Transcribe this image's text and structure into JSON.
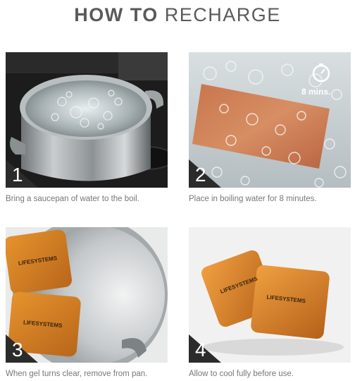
{
  "title": {
    "bold": "HOW TO",
    "light": "RECHARGE"
  },
  "steps": [
    {
      "number": "1",
      "caption": "Bring a saucepan of water to the boil."
    },
    {
      "number": "2",
      "caption": "Place in boiling water for 8 minutes.",
      "timer_label": "8 mins."
    },
    {
      "number": "3",
      "caption": "When gel turns clear, remove from pan."
    },
    {
      "number": "4",
      "caption": "Allow to cool fully before use."
    }
  ],
  "pack_brand": "LIFESYSTEMS"
}
